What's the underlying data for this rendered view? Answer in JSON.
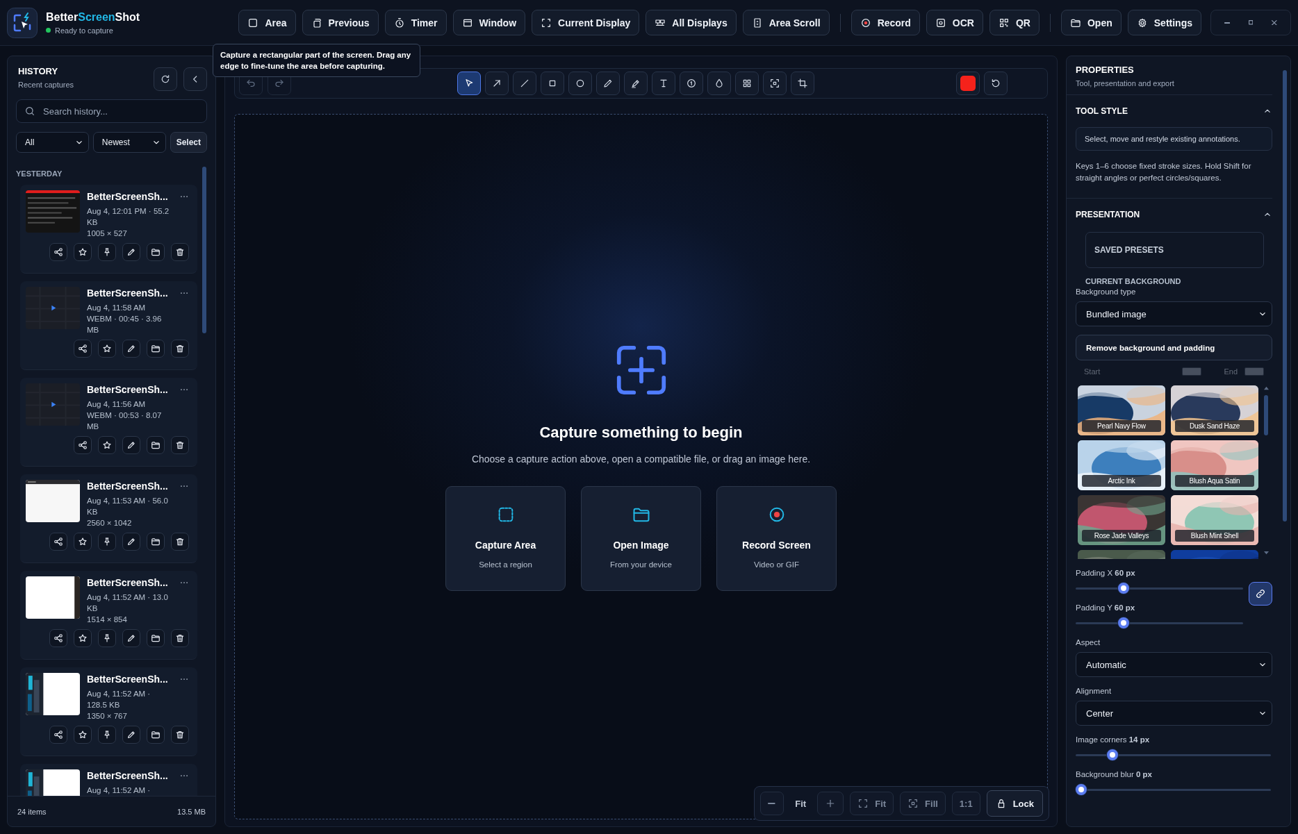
{
  "app": {
    "name_start": "Better",
    "name_accent": "Screen",
    "name_end": "Shot",
    "status": "Ready to capture"
  },
  "capture_toolbar": [
    [
      {
        "kind": "area",
        "label": "Area"
      },
      {
        "kind": "previous",
        "label": "Previous"
      },
      {
        "kind": "timer",
        "label": "Timer"
      },
      {
        "kind": "window",
        "label": "Window"
      },
      {
        "kind": "display",
        "label": "Current Display"
      },
      {
        "kind": "displays",
        "label": "All Displays"
      },
      {
        "kind": "scroll",
        "label": "Area Scroll"
      }
    ],
    [
      {
        "kind": "record",
        "label": "Record"
      },
      {
        "kind": "ocr",
        "label": "OCR"
      },
      {
        "kind": "qr",
        "label": "QR"
      }
    ],
    [
      {
        "kind": "open",
        "label": "Open"
      },
      {
        "kind": "settings",
        "label": "Settings"
      }
    ]
  ],
  "window_controls": [
    {
      "kind": "minimize"
    },
    {
      "kind": "maximize"
    },
    {
      "kind": "close"
    }
  ],
  "tooltip": "Capture a rectangular part of the screen. Drag any edge to fine-tune the area before capturing.",
  "history": {
    "title": "HISTORY",
    "subtitle": "Recent captures",
    "search": {
      "placeholder": "Search history..."
    },
    "filter": "All",
    "sort": "Newest",
    "select_button": "Select",
    "group": "YESTERDAY",
    "items": [
      {
        "name": "BetterScreenSh...",
        "lines": [
          "Aug 4, 12:01 PM · 55.2 KB",
          "1005 × 527"
        ],
        "actions": [
          {
            "kind": "share"
          },
          {
            "kind": "star"
          },
          {
            "kind": "pin"
          },
          {
            "kind": "edit"
          },
          {
            "kind": "folder"
          },
          {
            "kind": "delete"
          }
        ]
      },
      {
        "kind": "video",
        "name": "BetterScreenSh...",
        "lines": [
          "Aug 4, 11:58 AM",
          "WEBM · 00:45 · 3.96 MB"
        ],
        "actions": [
          {
            "kind": "share"
          },
          {
            "kind": "star"
          },
          {
            "kind": "edit"
          },
          {
            "kind": "folder"
          },
          {
            "kind": "delete"
          }
        ]
      },
      {
        "kind": "video",
        "name": "BetterScreenSh...",
        "lines": [
          "Aug 4, 11:56 AM",
          "WEBM · 00:53 · 8.07 MB"
        ],
        "actions": [
          {
            "kind": "share"
          },
          {
            "kind": "star"
          },
          {
            "kind": "edit"
          },
          {
            "kind": "folder"
          },
          {
            "kind": "delete"
          }
        ]
      },
      {
        "name": "BetterScreenSh...",
        "lines": [
          "Aug 4, 11:53 AM · 56.0 KB",
          "2560 × 1042"
        ],
        "actions": [
          {
            "kind": "share"
          },
          {
            "kind": "star"
          },
          {
            "kind": "pin"
          },
          {
            "kind": "edit"
          },
          {
            "kind": "folder"
          },
          {
            "kind": "delete"
          }
        ]
      },
      {
        "name": "BetterScreenSh...",
        "lines": [
          "Aug 4, 11:52 AM · 13.0 KB",
          "1514 × 854"
        ],
        "actions": [
          {
            "kind": "share"
          },
          {
            "kind": "star"
          },
          {
            "kind": "pin"
          },
          {
            "kind": "edit"
          },
          {
            "kind": "folder"
          },
          {
            "kind": "delete"
          }
        ]
      },
      {
        "name": "BetterScreenSh...",
        "lines": [
          "Aug 4, 11:52 AM · 128.5 KB",
          "1350 × 767"
        ],
        "actions": [
          {
            "kind": "share"
          },
          {
            "kind": "star"
          },
          {
            "kind": "pin"
          },
          {
            "kind": "edit"
          },
          {
            "kind": "folder"
          },
          {
            "kind": "delete"
          }
        ]
      },
      {
        "name": "BetterScreenSh...",
        "lines": [
          "Aug 4, 11:52 AM ·"
        ]
      }
    ],
    "count": "24 items",
    "size": "13.5 MB"
  },
  "editor": {
    "undo": {
      "disabled": true
    },
    "redo": {
      "disabled": true
    },
    "tools": [
      {
        "kind": "select",
        "selected": true
      },
      {
        "kind": "arrow",
        "selected": false
      },
      {
        "kind": "line",
        "selected": false
      },
      {
        "kind": "rect",
        "selected": false
      },
      {
        "kind": "ellipse",
        "selected": false
      },
      {
        "kind": "pen",
        "selected": false
      },
      {
        "kind": "highlighter",
        "selected": false
      },
      {
        "kind": "text",
        "selected": false
      },
      {
        "kind": "counter",
        "selected": false
      },
      {
        "kind": "blur",
        "selected": false
      },
      {
        "kind": "pixelate",
        "selected": false
      },
      {
        "kind": "spotlight",
        "selected": false
      },
      {
        "kind": "crop",
        "selected": false
      }
    ],
    "color": "#f5221b"
  },
  "empty_state": {
    "title": "Capture something to begin",
    "subtitle": "Choose a capture action above, open a compatible file, or drag an image here.",
    "cards": [
      {
        "kind": "area",
        "title": "Capture Area",
        "subtitle": "Select a region"
      },
      {
        "kind": "open",
        "title": "Open Image",
        "subtitle": "From your device"
      },
      {
        "kind": "record",
        "title": "Record Screen",
        "subtitle": "Video or GIF"
      }
    ]
  },
  "zoom_bar": [
    {
      "kind": "zoom_out",
      "disabled": true
    },
    {
      "kind": "level",
      "label": "Fit"
    },
    {
      "kind": "zoom_in",
      "disabled": true
    },
    {
      "kind": "fit",
      "label": "Fit",
      "disabled": true
    },
    {
      "kind": "fill",
      "label": "Fill",
      "disabled": true
    },
    {
      "kind": "actual",
      "label": "1:1",
      "disabled": true
    },
    {
      "kind": "lock",
      "label": "Lock",
      "disabled": false
    }
  ],
  "properties": {
    "title": "PROPERTIES",
    "subtitle": "Tool, presentation and export",
    "tool_style": {
      "title": "TOOL STYLE",
      "expanded": true,
      "info": "Select, move and restyle existing annotations.",
      "help": "Keys 1–6 choose fixed stroke sizes. Hold Shift for straight angles or perfect circles/squares."
    },
    "presentation": {
      "title": "PRESENTATION",
      "expanded": true,
      "saved_presets": "SAVED PRESETS",
      "current_background": "CURRENT BACKGROUND",
      "background_type": {
        "label": "Background type",
        "value": "Bundled image"
      },
      "remove_button": "Remove background and padding",
      "gradient": {
        "disabled": true,
        "start_label": "Start",
        "end_label": "End"
      },
      "backgrounds": [
        {
          "kind": "picture",
          "label": "Pearl Navy Flow"
        },
        {
          "kind": "picture",
          "label": "Dusk Sand Haze"
        },
        {
          "kind": "picture",
          "label": "Arctic Ink"
        },
        {
          "kind": "picture",
          "label": "Blush Aqua Satin"
        },
        {
          "kind": "picture",
          "label": "Rose Jade Valleys"
        },
        {
          "kind": "picture",
          "label": "Blush Mint Shell"
        },
        {
          "kind": "picture"
        },
        {
          "kind": "picture"
        }
      ],
      "padding_x": {
        "label": "Padding X **60 px**",
        "level": 0.27
      },
      "padding_y": {
        "label": "Padding Y **60 px**",
        "level": 0.27
      },
      "padding_linked": true,
      "aspect": {
        "label": "Aspect",
        "value": "Automatic"
      },
      "alignment": {
        "label": "Alignment",
        "value": "Center"
      },
      "image_corners": {
        "label": "Image corners **14 px**",
        "level": 0.17
      },
      "background_blur": {
        "label": "Background blur **0 px**",
        "level": 0
      }
    }
  }
}
